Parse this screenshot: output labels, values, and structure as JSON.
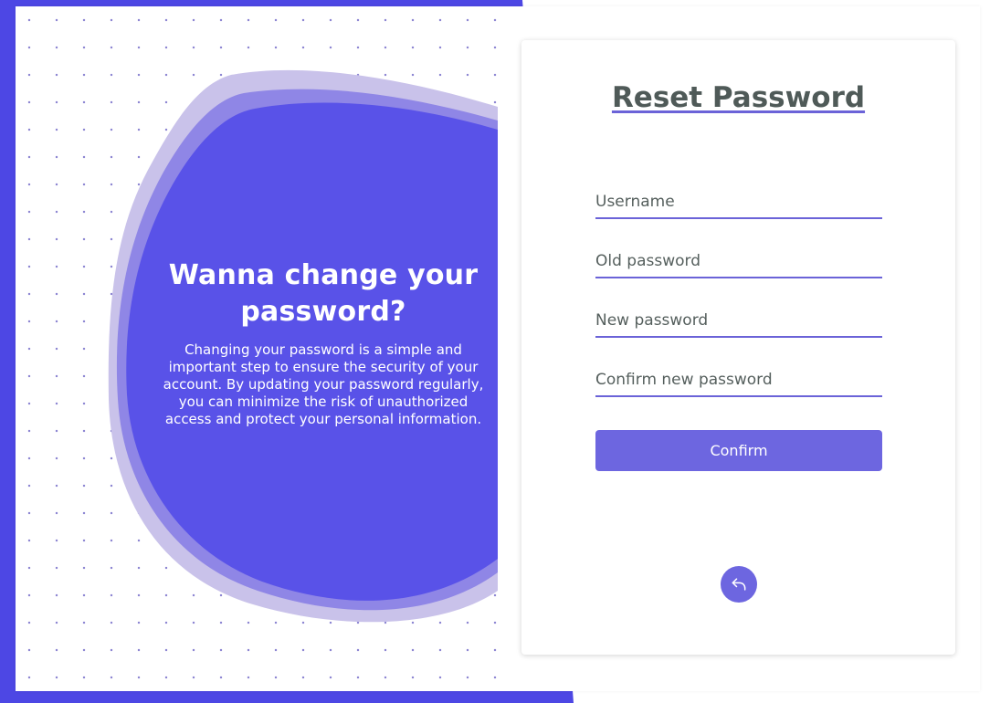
{
  "promo": {
    "heading": "Wanna change your password?",
    "body": "Changing your password is a simple and important step to ensure the security of your account. By updating your password regularly, you can minimize the risk of unauthorized access and protect your personal information."
  },
  "form": {
    "title": "Reset Password",
    "username_placeholder": "Username",
    "old_password_placeholder": "Old password",
    "new_password_placeholder": "New password",
    "confirm_password_placeholder": "Confirm new password",
    "confirm_label": "Confirm"
  },
  "icons": {
    "back": "undo-arrow-icon"
  },
  "colors": {
    "accent": "#6d66e0",
    "blob": "#5952e8",
    "backdrop": "#4d47e4",
    "title": "#4f5a58"
  }
}
